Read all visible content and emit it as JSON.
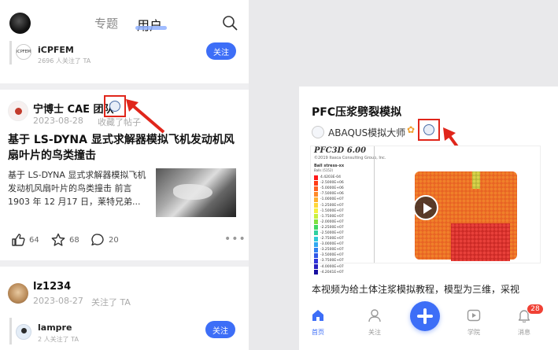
{
  "header": {
    "tabs": [
      {
        "label": "专题",
        "active": false
      },
      {
        "label": "用户",
        "active": true
      }
    ]
  },
  "follow_rows": [
    {
      "name": "iCPFEM",
      "logo_text": "iCPFEM",
      "followers": "2696 人关注了 TA",
      "button": "关注"
    },
    {
      "name": "lampre",
      "followers": "2 人关注了 TA",
      "button": "关注"
    }
  ],
  "post": {
    "author": "宁博士 CAE 团队",
    "date": "2023-08-28",
    "action": "收藏了帖子",
    "title": "基于 LS-DYNA 显式求解器模拟飞机发动机风扇叶片的鸟类撞击",
    "excerpt": "基于 LS-DYNA 显式求解器模拟飞机发动机风扇叶片的鸟类撞击 前言 1903 年 12 月17 日，莱特兄弟...",
    "likes": "64",
    "stars": "68",
    "comments": "20"
  },
  "user2": {
    "name": "lz1234",
    "date": "2023-08-27",
    "action": "关注了 TA"
  },
  "right_post": {
    "title": "PFC压浆劈裂模拟",
    "author": "ABAQUS模拟大师",
    "description": "本视频为给土体注浆模拟教程，模型为三维，采视",
    "video": {
      "title": "PFC3D 6.00",
      "copyright": "©2019 Itasca Consulting Group, Inc.",
      "legend_title": "Ball stress-xx",
      "legend_subtitle": "Balls (5152)",
      "legend": [
        {
          "label": "4.4203E-04",
          "color": "#ff1a1a"
        },
        {
          "label": "-2.5000E+06",
          "color": "#ff3a14"
        },
        {
          "label": "-5.0000E+06",
          "color": "#ff6020"
        },
        {
          "label": "-7.5000E+06",
          "color": "#ff8a28"
        },
        {
          "label": "-1.0000E+07",
          "color": "#ffb030"
        },
        {
          "label": "-1.2500E+07",
          "color": "#ffd83a"
        },
        {
          "label": "-1.5000E+07",
          "color": "#f4f040"
        },
        {
          "label": "-1.7500E+07",
          "color": "#c8f040"
        },
        {
          "label": "-2.0000E+07",
          "color": "#80e040"
        },
        {
          "label": "-2.2500E+07",
          "color": "#40d860"
        },
        {
          "label": "-2.5000E+07",
          "color": "#30d0a0"
        },
        {
          "label": "-2.7500E+07",
          "color": "#30c8d8"
        },
        {
          "label": "-3.0000E+07",
          "color": "#30a8f0"
        },
        {
          "label": "-3.2500E+07",
          "color": "#3080f0"
        },
        {
          "label": "-3.5000E+07",
          "color": "#3058e8"
        },
        {
          "label": "-3.7500E+07",
          "color": "#3034d8"
        },
        {
          "label": "-4.0000E+07",
          "color": "#2820c0"
        },
        {
          "label": "-4.2041E+07",
          "color": "#1810a0"
        }
      ]
    }
  },
  "tabbar": {
    "items": [
      {
        "label": "首页",
        "icon": "home-icon",
        "active": true
      },
      {
        "label": "关注",
        "icon": "person-icon",
        "active": false
      },
      {
        "label": "学院",
        "icon": "play-square-icon",
        "active": false
      },
      {
        "label": "消息",
        "icon": "bell-icon",
        "active": false
      }
    ],
    "notification_count": "28"
  },
  "colors": {
    "accent": "#3d6ef7",
    "highlight_red": "#e0261b",
    "badge_red": "#f04135"
  }
}
